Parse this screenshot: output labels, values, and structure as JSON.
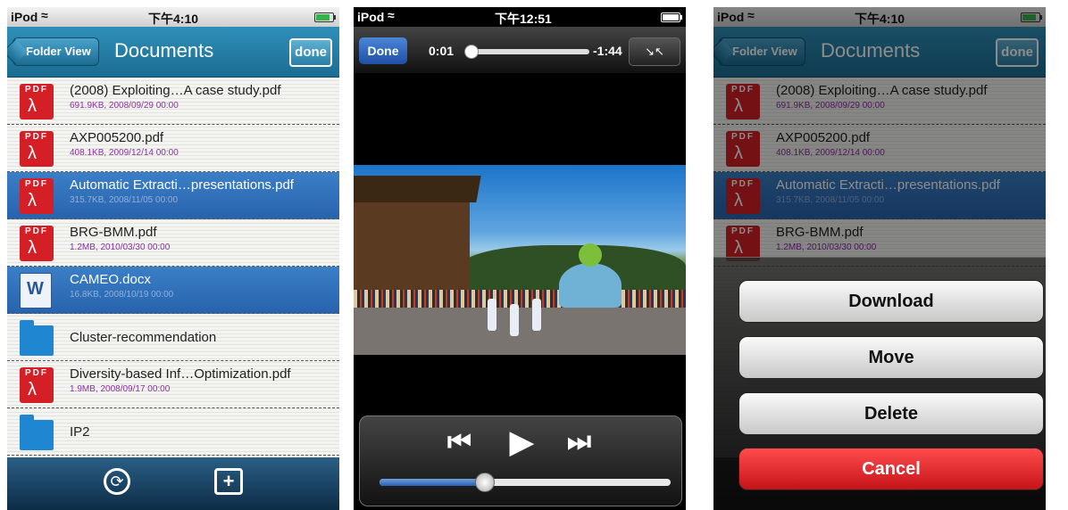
{
  "status": {
    "left": {
      "carrier": "iPod",
      "time": "下午4:10"
    },
    "middle": {
      "carrier": "iPod",
      "time": "下午12:51"
    },
    "right": {
      "carrier": "iPod",
      "time": "下午4:10"
    }
  },
  "nav": {
    "back_label": "Folder View",
    "title": "Documents",
    "done_label": "done"
  },
  "files": [
    {
      "name": "(2008) Exploiting…A case study.pdf",
      "meta": "691.9KB, 2008/09/29 00:00",
      "type": "pdf",
      "selected": false
    },
    {
      "name": "AXP005200.pdf",
      "meta": "408.1KB, 2009/12/14 00:00",
      "type": "pdf",
      "selected": false
    },
    {
      "name": "Automatic Extracti…presentations.pdf",
      "meta": "315.7KB, 2008/11/05 00:00",
      "type": "pdf",
      "selected": true
    },
    {
      "name": "BRG-BMM.pdf",
      "meta": "1.2MB, 2010/03/30 00:00",
      "type": "pdf",
      "selected": false
    },
    {
      "name": "CAMEO.docx",
      "meta": "16.8KB, 2008/10/19 00:00",
      "type": "docx",
      "selected": true
    },
    {
      "name": "Cluster-recommendation",
      "meta": "",
      "type": "folder",
      "selected": false
    },
    {
      "name": "Diversity-based Inf…Optimization.pdf",
      "meta": "1.9MB, 2008/09/17 00:00",
      "type": "pdf",
      "selected": false
    },
    {
      "name": "IP2",
      "meta": "",
      "type": "folder",
      "selected": false
    }
  ],
  "icons": {
    "pdf_label": "PDF",
    "word_label": "W",
    "refresh": "refresh-icon",
    "new_folder": "new-folder-icon",
    "wifi": "wifi-icon",
    "battery": "battery-icon"
  },
  "player": {
    "done_label": "Done",
    "elapsed": "0:01",
    "remaining": "-1:44",
    "scrub_progress": 0.01,
    "volume_level": 0.36
  },
  "actions": {
    "download": "Download",
    "move": "Move",
    "delete": "Delete",
    "cancel": "Cancel"
  },
  "colors": {
    "nav_blue": "#2f8fb8",
    "selection_blue": "#3b7fc7",
    "pdf_red": "#d41f26",
    "meta_purple": "#8b2fa5",
    "cancel_red": "#d41f26"
  }
}
